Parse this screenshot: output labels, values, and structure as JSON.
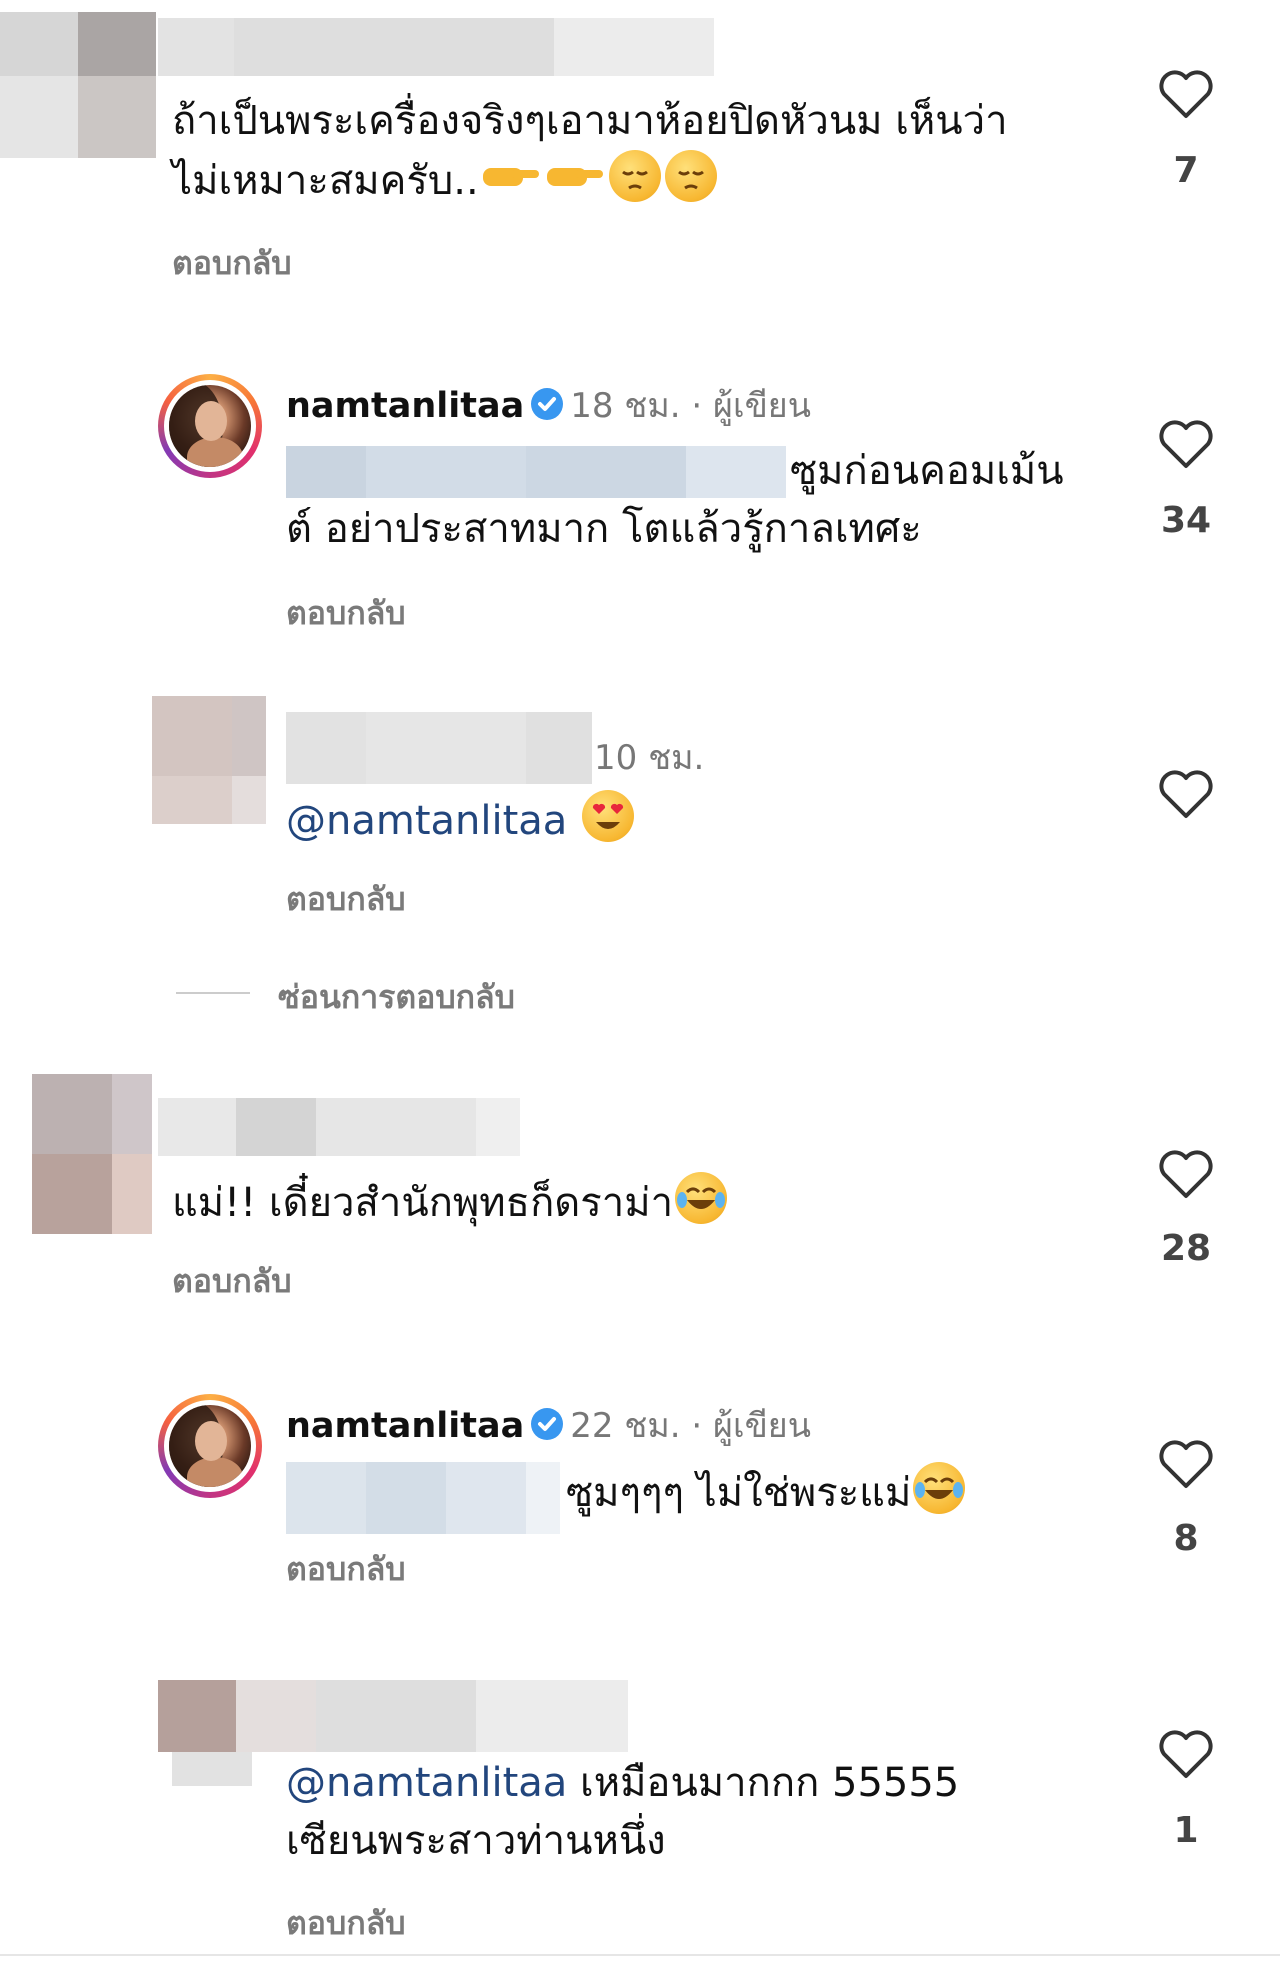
{
  "comments": [
    {
      "text_line1": "ถ้าเป็นพระเครื่องจริงๆเอามาห้อยปิดหัวนม เห็นว่า",
      "text_line2": "ไม่เหมาะสมครับ..",
      "reply": "ตอบกลับ",
      "likes": "7"
    },
    {
      "username": "namtanlitaa",
      "meta": "18 ชม. · ผู้เขียน",
      "text_line1": "ซูมก่อนคอมเม้น",
      "text_line2": "ต์ อย่าประสาทมาก โตแล้วรู้กาลเทศะ",
      "reply": "ตอบกลับ",
      "likes": "34"
    },
    {
      "meta": "10 ชม.",
      "mention": "@namtanlitaa",
      "reply": "ตอบกลับ"
    },
    {
      "text_line1": "แม่!! เดี๋ยวสำนักพุทธก็ดราม่า",
      "reply": "ตอบกลับ",
      "likes": "28"
    },
    {
      "username": "namtanlitaa",
      "meta": "22 ชม. · ผู้เขียน",
      "text_line1": "ซูมๆๆๆ ไม่ใช่พระแม่",
      "reply": "ตอบกลับ",
      "likes": "8"
    },
    {
      "mention": "@namtanlitaa",
      "text_line1": " เหมือนมากกก 55555",
      "text_line2": "เซียนพระสาวท่านหนึ่ง",
      "reply": "ตอบกลับ",
      "likes": "1"
    }
  ],
  "hide_replies": "ซ่อนการตอบกลับ",
  "colors": {
    "mention": "#22467d",
    "verified": "#3897f0",
    "muted": "#7a7a7a"
  },
  "icons": [
    "heart-icon",
    "verified-badge-icon",
    "avatar",
    "emoji"
  ]
}
